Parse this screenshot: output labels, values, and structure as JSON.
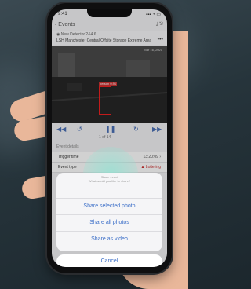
{
  "status": {
    "time": "9:41",
    "icons": "▪▪▪ ◔ ▭"
  },
  "nav": {
    "back_label": "‹  Events",
    "icons": "⤓  ⎋"
  },
  "camera": {
    "name": "◉ New Detector 2&4 6",
    "location": "LSH Manchester Central Offsite Storage Extreme Area",
    "more": "•••"
  },
  "video": {
    "overlay": "Mar 16, 2021",
    "bbox_label": "person 0.91"
  },
  "controls": {
    "skip_back": "◀◀",
    "rewind": "↺",
    "pause": "❚❚",
    "forward": "↻",
    "skip_forward": "▶▶",
    "counter": "1 of 14"
  },
  "details": {
    "section": "Event details",
    "rows": [
      {
        "label": "Trigger time",
        "value": "13:20:09 ›"
      },
      {
        "label": "Event type",
        "value": "▲ Loitering"
      }
    ]
  },
  "sheet": {
    "title": "Share event",
    "subtitle": "What would you like to share?",
    "options": [
      "Share selected photo",
      "Share all photos",
      "Share as video"
    ],
    "cancel": "Cancel"
  },
  "colors": {
    "accent": "#3c6fc8",
    "bbox": "#e22222",
    "touch": "#96e1d2"
  }
}
